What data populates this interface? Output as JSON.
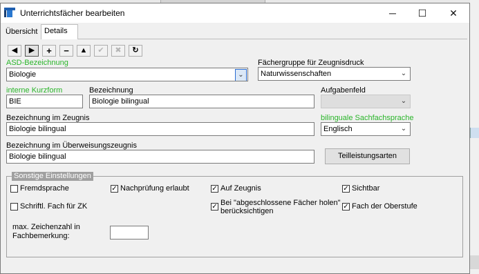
{
  "window": {
    "title": "Unterrichtsfächer bearbeiten",
    "minimize": "─",
    "maximize": "☐",
    "close": "✕"
  },
  "tabs": [
    {
      "label": "Übersicht",
      "active": false
    },
    {
      "label": "Details",
      "active": true
    }
  ],
  "toolbar": {
    "prev": "◀",
    "next": "▶",
    "add": "+",
    "remove": "−",
    "up": "▲",
    "confirm": "✔",
    "cancel": "✖",
    "refresh": "↻"
  },
  "form": {
    "asd_label": "ASD-Bezeichnung",
    "asd_value": "Biologie",
    "faechergruppe_label": "Fächergruppe für Zeugnisdruck",
    "faechergruppe_value": "Naturwissenschaften",
    "kurzform_label": "interne Kurzform",
    "kurzform_value": "BIE",
    "bezeichnung_label": "Bezeichnung",
    "bezeichnung_value": "Biologie bilingual",
    "aufgabenfeld_label": "Aufgabenfeld",
    "aufgabenfeld_value": "",
    "zeugnis_label": "Bezeichnung im Zeugnis",
    "zeugnis_value": "Biologie bilingual",
    "sachfach_label": "bilinguale Sachfachsprache",
    "sachfach_value": "Englisch",
    "ueberweisung_label": "Bezeichnung im Überweisungszeugnis",
    "ueberweisung_value": "Biologie bilingual",
    "teilleistung_button": "Teilleistungsarten"
  },
  "settings": {
    "title": "Sonstige Einstellungen",
    "fremdsprache": {
      "label": "Fremdsprache",
      "checked": false
    },
    "nachpruefung": {
      "label": "Nachprüfung erlaubt",
      "checked": true
    },
    "auf_zeugnis": {
      "label": "Auf Zeugnis",
      "checked": true
    },
    "sichtbar": {
      "label": "Sichtbar",
      "checked": true
    },
    "schriftl": {
      "label": "Schriftl. Fach für ZK",
      "checked": false
    },
    "abgeschlossen": {
      "label_line1": "Bei \"abgeschlossene Fächer holen\"",
      "label_line2": "berücksichtigen",
      "checked": true
    },
    "oberstufe": {
      "label": "Fach der Oberstufe",
      "checked": true
    },
    "max_zeichen_line1": "max. Zeichenzahl in",
    "max_zeichen_line2": "Fachbemerkung:",
    "max_zeichen_value": ""
  },
  "icons": {
    "check": "✓",
    "dropdown": "⌄"
  }
}
